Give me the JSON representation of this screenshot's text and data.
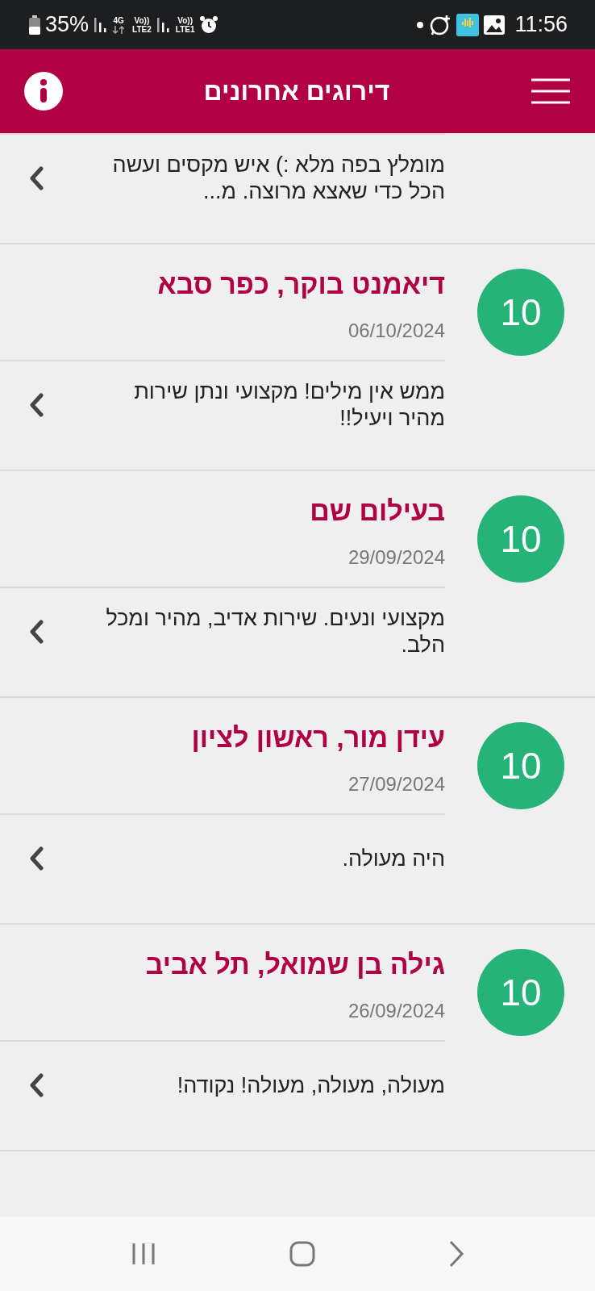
{
  "status_bar": {
    "battery": "35%",
    "networks": [
      {
        "kind": "volte",
        "top": "Vo))",
        "bottom": "LTE1"
      },
      {
        "kind": "volte",
        "top": "Vo))",
        "bottom": "LTE2"
      },
      {
        "kind": "data",
        "label": "4G"
      }
    ],
    "time": "11:56"
  },
  "header": {
    "title": "דירוגים אחרונים"
  },
  "reviews": [
    {
      "kind": "partial",
      "comment": "מומלץ בפה מלא :) איש מקסים ועשה הכל כדי שאצא מרוצה. מ..."
    },
    {
      "kind": "full",
      "score": "10",
      "name": "דיאמנט בוקר, כפר סבא",
      "date": "06/10/2024",
      "comment": "ממש אין מילים! מקצועי ונתן שירות מהיר ויעיל!!"
    },
    {
      "kind": "full",
      "score": "10",
      "name": "בעילום שם",
      "date": "29/09/2024",
      "comment": "מקצועי ונעים. שירות אדיב, מהיר ומכל הלב."
    },
    {
      "kind": "full",
      "score": "10",
      "name": "עידן מור, ראשון לציון",
      "date": "27/09/2024",
      "comment": "היה מעולה."
    },
    {
      "kind": "full",
      "score": "10",
      "name": "גילה בן שמואל, תל אביב",
      "date": "26/09/2024",
      "comment": "מעולה, מעולה, מעולה! נקודה!"
    }
  ]
}
